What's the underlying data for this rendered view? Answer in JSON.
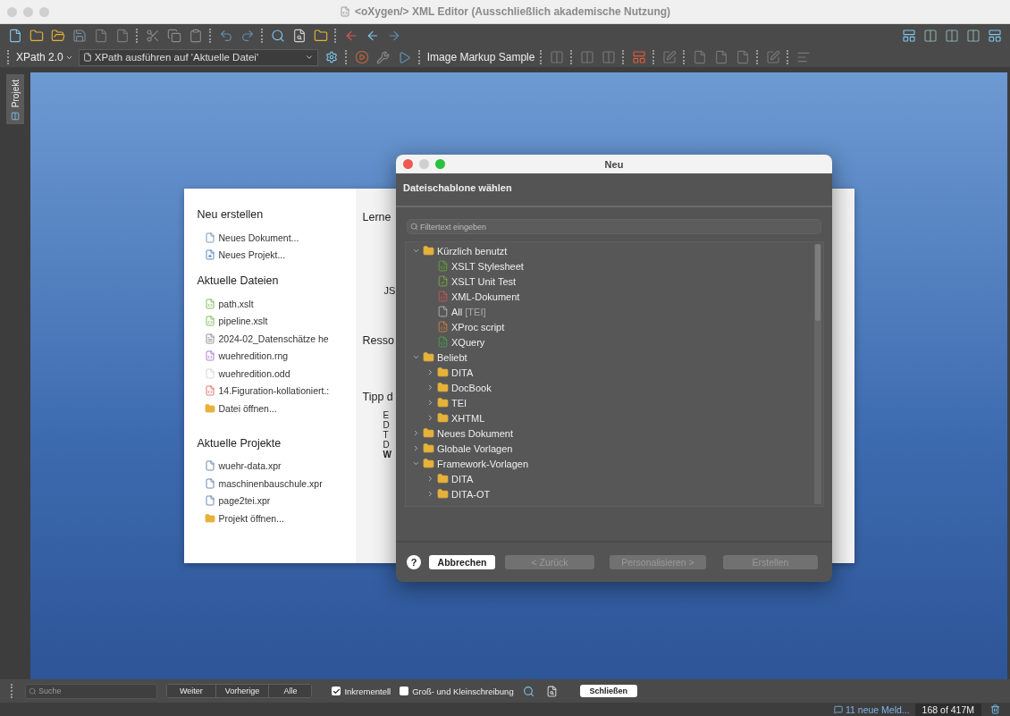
{
  "window": {
    "title": "<oXygen/> XML Editor (Ausschließlich akademische Nutzung)"
  },
  "toolbar": {
    "xpath_version": "XPath 2.0",
    "xpath_scope": "XPath ausführen auf  'Aktuelle Datei'",
    "transform_scenario": "Image Markup Sample"
  },
  "side_tab": {
    "label": "Projekt"
  },
  "welcome": {
    "sections": [
      {
        "title": "Neu erstellen",
        "items": [
          {
            "label": "Neues Dokument...",
            "kind": "document"
          },
          {
            "label": "Neues Projekt...",
            "kind": "project"
          }
        ]
      },
      {
        "title": "Aktuelle Dateien",
        "items": [
          {
            "label": "path.xslt",
            "kind": "xslt"
          },
          {
            "label": "pipeline.xslt",
            "kind": "xslt"
          },
          {
            "label": "2024-02_Datenschätze he",
            "kind": "markdown"
          },
          {
            "label": "wuehredition.rng",
            "kind": "schema"
          },
          {
            "label": "wuehredition.odd",
            "kind": "plain"
          },
          {
            "label": "14.Figuration-kollationiert.:",
            "kind": "xml"
          },
          {
            "label": "Datei öffnen...",
            "kind": "folder"
          }
        ]
      },
      {
        "title": "Aktuelle Projekte",
        "items": [
          {
            "label": "wuehr-data.xpr",
            "kind": "project-file"
          },
          {
            "label": "maschinenbauschule.xpr",
            "kind": "project-file"
          },
          {
            "label": "page2tei.xpr",
            "kind": "project-file"
          },
          {
            "label": "Projekt öffnen...",
            "kind": "folder"
          }
        ]
      }
    ],
    "right_headings": [
      "Lerne",
      "JS",
      "Resso",
      "Tipp d"
    ],
    "tip_lines": [
      "E",
      "D",
      "T",
      "D",
      "W"
    ]
  },
  "dialog": {
    "title": "Neu",
    "heading": "Dateischablone wählen",
    "filter": {
      "placeholder": "Filtertext eingeben"
    },
    "tree": [
      {
        "label": "Kürzlich benutzt",
        "kind": "folder",
        "expanded": true,
        "children": [
          {
            "label": "XSLT Stylesheet",
            "kind": "xslt"
          },
          {
            "label": "XSLT Unit Test",
            "kind": "test"
          },
          {
            "label": "XML-Dokument",
            "kind": "xml"
          },
          {
            "label": "All",
            "tag": "[TEI]",
            "kind": "tei"
          },
          {
            "label": "XProc script",
            "kind": "xproc"
          },
          {
            "label": "XQuery",
            "kind": "xquery"
          }
        ]
      },
      {
        "label": "Beliebt",
        "kind": "folder",
        "expanded": true,
        "children": [
          {
            "label": "DITA",
            "kind": "folder",
            "expanded": false
          },
          {
            "label": "DocBook",
            "kind": "folder",
            "expanded": false
          },
          {
            "label": "TEI",
            "kind": "folder",
            "expanded": false
          },
          {
            "label": "XHTML",
            "kind": "folder",
            "expanded": false
          }
        ]
      },
      {
        "label": "Neues Dokument",
        "kind": "folder",
        "expanded": false
      },
      {
        "label": "Globale Vorlagen",
        "kind": "folder",
        "expanded": false
      },
      {
        "label": "Framework-Vorlagen",
        "kind": "folder",
        "expanded": true,
        "children": [
          {
            "label": "DITA",
            "kind": "folder",
            "expanded": false
          },
          {
            "label": "DITA-OT",
            "kind": "folder",
            "expanded": false
          }
        ]
      }
    ],
    "help": "?",
    "buttons": [
      {
        "label": "Abbrechen",
        "disabled": false
      },
      {
        "label": "< Zurück",
        "disabled": true
      },
      {
        "label": "Personalisieren >",
        "disabled": true
      },
      {
        "label": "Erstellen",
        "disabled": true
      }
    ]
  },
  "find_bar": {
    "search": {
      "placeholder": "Suche"
    },
    "buttons": [
      "Weiter",
      "Vorherige",
      "Alle"
    ],
    "options": [
      {
        "label": "Inkrementell",
        "checked": true
      },
      {
        "label": "Groß- und Kleinschreibung",
        "checked": false
      }
    ],
    "close": "Schließen"
  },
  "status_bar": {
    "messages": "11 neue Meld...",
    "memory": "168 of 417M"
  }
}
